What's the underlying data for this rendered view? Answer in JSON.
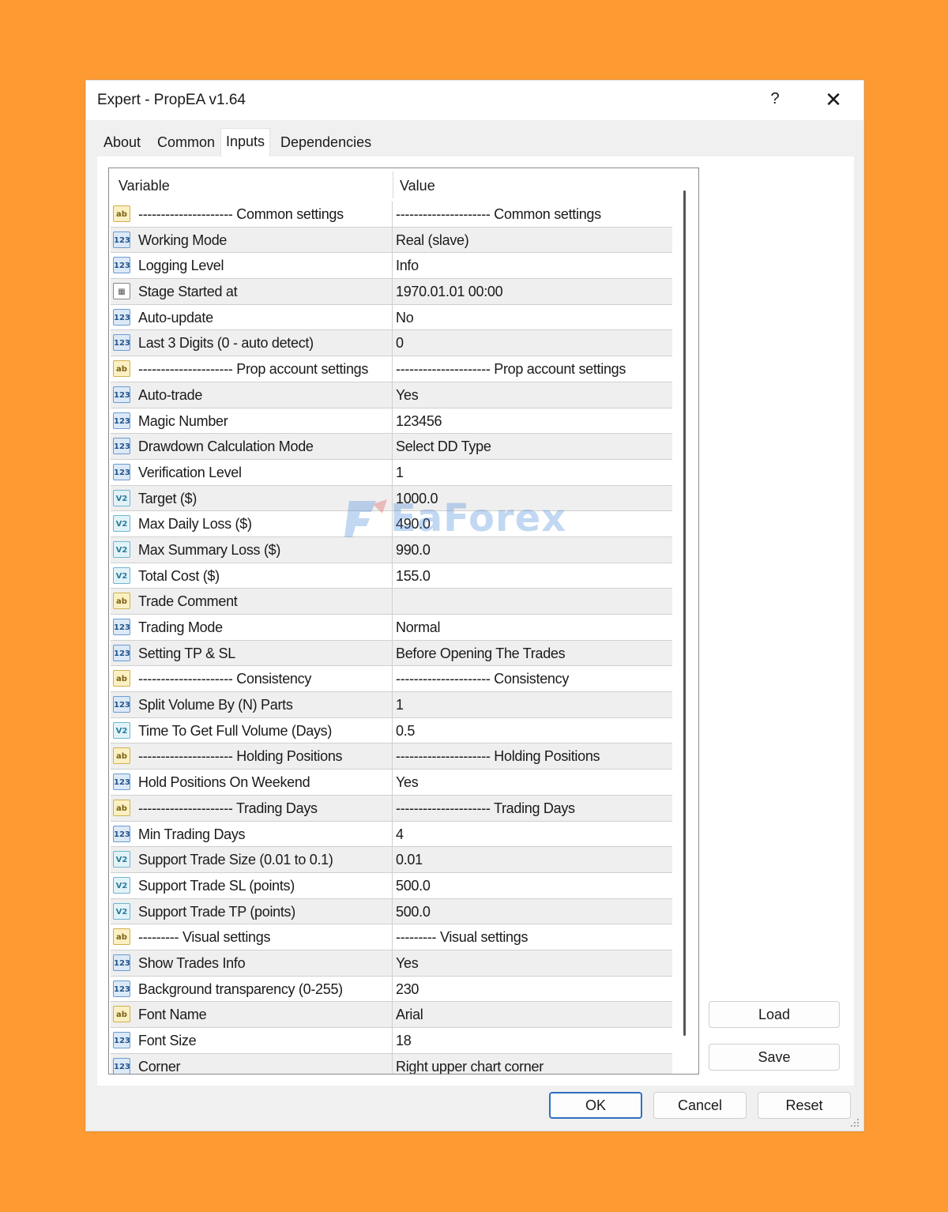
{
  "dialog": {
    "title": "Expert - PropEA v1.64",
    "help_label": "?",
    "close_label": "✕"
  },
  "tabs": [
    "About",
    "Common",
    "Inputs",
    "Dependencies"
  ],
  "active_tab": "Inputs",
  "grid": {
    "header_variable": "Variable",
    "header_value": "Value",
    "rows": [
      {
        "icon": "str",
        "var": "--------------------- Common settings",
        "val": "--------------------- Common settings"
      },
      {
        "icon": "int",
        "var": "Working Mode",
        "val": "Real (slave)"
      },
      {
        "icon": "int",
        "var": "Logging Level",
        "val": "Info"
      },
      {
        "icon": "dt",
        "var": "Stage Started at",
        "val": "1970.01.01 00:00"
      },
      {
        "icon": "int",
        "var": "Auto-update",
        "val": "No"
      },
      {
        "icon": "int",
        "var": "Last 3 Digits (0 - auto detect)",
        "val": "0"
      },
      {
        "icon": "str",
        "var": "--------------------- Prop account settings",
        "val": "--------------------- Prop account settings"
      },
      {
        "icon": "int",
        "var": "Auto-trade",
        "val": "Yes"
      },
      {
        "icon": "int",
        "var": "Magic Number",
        "val": "123456"
      },
      {
        "icon": "int",
        "var": "Drawdown Calculation Mode",
        "val": "Select DD Type"
      },
      {
        "icon": "int",
        "var": "Verification Level",
        "val": "1"
      },
      {
        "icon": "dbl",
        "var": "Target ($)",
        "val": "1000.0"
      },
      {
        "icon": "dbl",
        "var": "Max Daily Loss ($)",
        "val": "490.0"
      },
      {
        "icon": "dbl",
        "var": "Max Summary Loss ($)",
        "val": "990.0"
      },
      {
        "icon": "dbl",
        "var": "Total Cost ($)",
        "val": "155.0"
      },
      {
        "icon": "str",
        "var": "Trade Comment",
        "val": ""
      },
      {
        "icon": "int",
        "var": "Trading Mode",
        "val": "Normal"
      },
      {
        "icon": "int",
        "var": "Setting TP & SL",
        "val": "Before Opening The Trades"
      },
      {
        "icon": "str",
        "var": "--------------------- Consistency",
        "val": "--------------------- Consistency"
      },
      {
        "icon": "int",
        "var": "Split Volume By (N) Parts",
        "val": "1"
      },
      {
        "icon": "dbl",
        "var": "Time To Get Full Volume (Days)",
        "val": "0.5"
      },
      {
        "icon": "str",
        "var": "--------------------- Holding Positions",
        "val": "--------------------- Holding Positions"
      },
      {
        "icon": "int",
        "var": "Hold Positions On Weekend",
        "val": "Yes"
      },
      {
        "icon": "str",
        "var": "--------------------- Trading Days",
        "val": "--------------------- Trading Days"
      },
      {
        "icon": "int",
        "var": "Min Trading Days",
        "val": "4"
      },
      {
        "icon": "dbl",
        "var": "Support Trade Size (0.01 to 0.1)",
        "val": "0.01"
      },
      {
        "icon": "dbl",
        "var": "Support Trade SL (points)",
        "val": "500.0"
      },
      {
        "icon": "dbl",
        "var": "Support Trade TP (points)",
        "val": "500.0"
      },
      {
        "icon": "str",
        "var": "--------- Visual settings",
        "val": "--------- Visual settings"
      },
      {
        "icon": "int",
        "var": "Show Trades Info",
        "val": "Yes"
      },
      {
        "icon": "int",
        "var": "Background transparency (0-255)",
        "val": "230"
      },
      {
        "icon": "str",
        "var": "Font Name",
        "val": "Arial"
      },
      {
        "icon": "int",
        "var": "Font Size",
        "val": "18"
      },
      {
        "icon": "int",
        "var": "Corner",
        "val": "Right upper chart corner"
      }
    ]
  },
  "icon_labels": {
    "int": "123",
    "dbl": "V2",
    "str": "ab",
    "dt": "▦"
  },
  "buttons": {
    "load": "Load",
    "save": "Save",
    "ok": "OK",
    "cancel": "Cancel",
    "reset": "Reset"
  },
  "watermark": "EaForex"
}
